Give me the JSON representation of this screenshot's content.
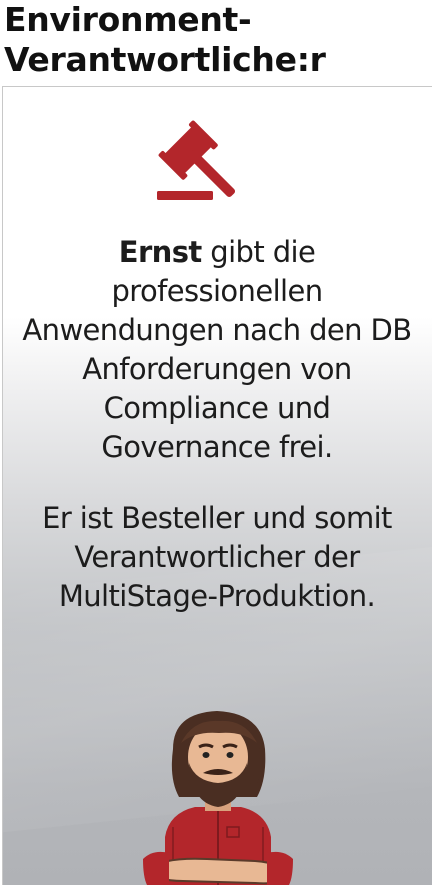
{
  "header": {
    "title": "Environment-Verantwortliche:r"
  },
  "card": {
    "icon": "gavel-icon",
    "accent_color": "#b3262b",
    "paragraph1": {
      "name": "Ernst",
      "text": " gibt die professionellen Anwendungen nach den DB Anforderungen von Compliance und Governance frei."
    },
    "paragraph2": "Er ist Besteller und somit Verantwortlicher der MultiStage-Produktion.",
    "avatar": "bearded-man-avatar"
  }
}
